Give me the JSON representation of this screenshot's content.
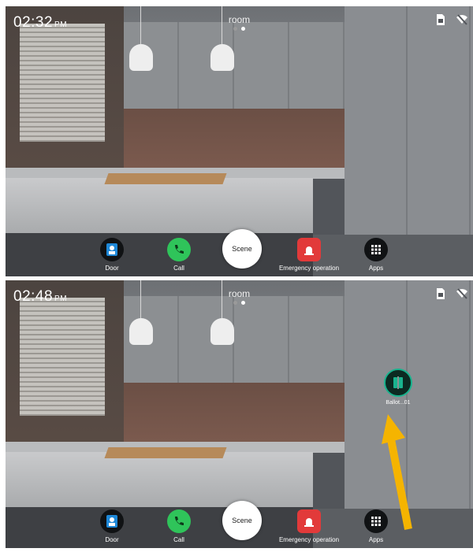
{
  "top_panel": {
    "time": "02:32",
    "ampm": "PM",
    "room_title": "room",
    "dock": {
      "door": "Door",
      "call": "Call",
      "scene": "Scene",
      "emergency": "Emergency operation",
      "apps": "Apps"
    }
  },
  "bottom_panel": {
    "time": "02:48",
    "ampm": "PM",
    "room_title": "room",
    "device_label": "Ballot...01",
    "dock": {
      "door": "Door",
      "call": "Call",
      "scene": "Scene",
      "emergency": "Emergency operation",
      "apps": "Apps"
    }
  },
  "colors": {
    "door_icon": "#1e88d8",
    "call_icon": "#2fc45a",
    "emergency_icon": "#e23a3a",
    "device_accent": "#19b38e",
    "annotation_arrow": "#f5b400"
  },
  "icons": [
    "door-icon",
    "call-icon",
    "emergency-icon",
    "apps-icon",
    "device-icon",
    "sim-icon",
    "wifi-off-icon"
  ]
}
